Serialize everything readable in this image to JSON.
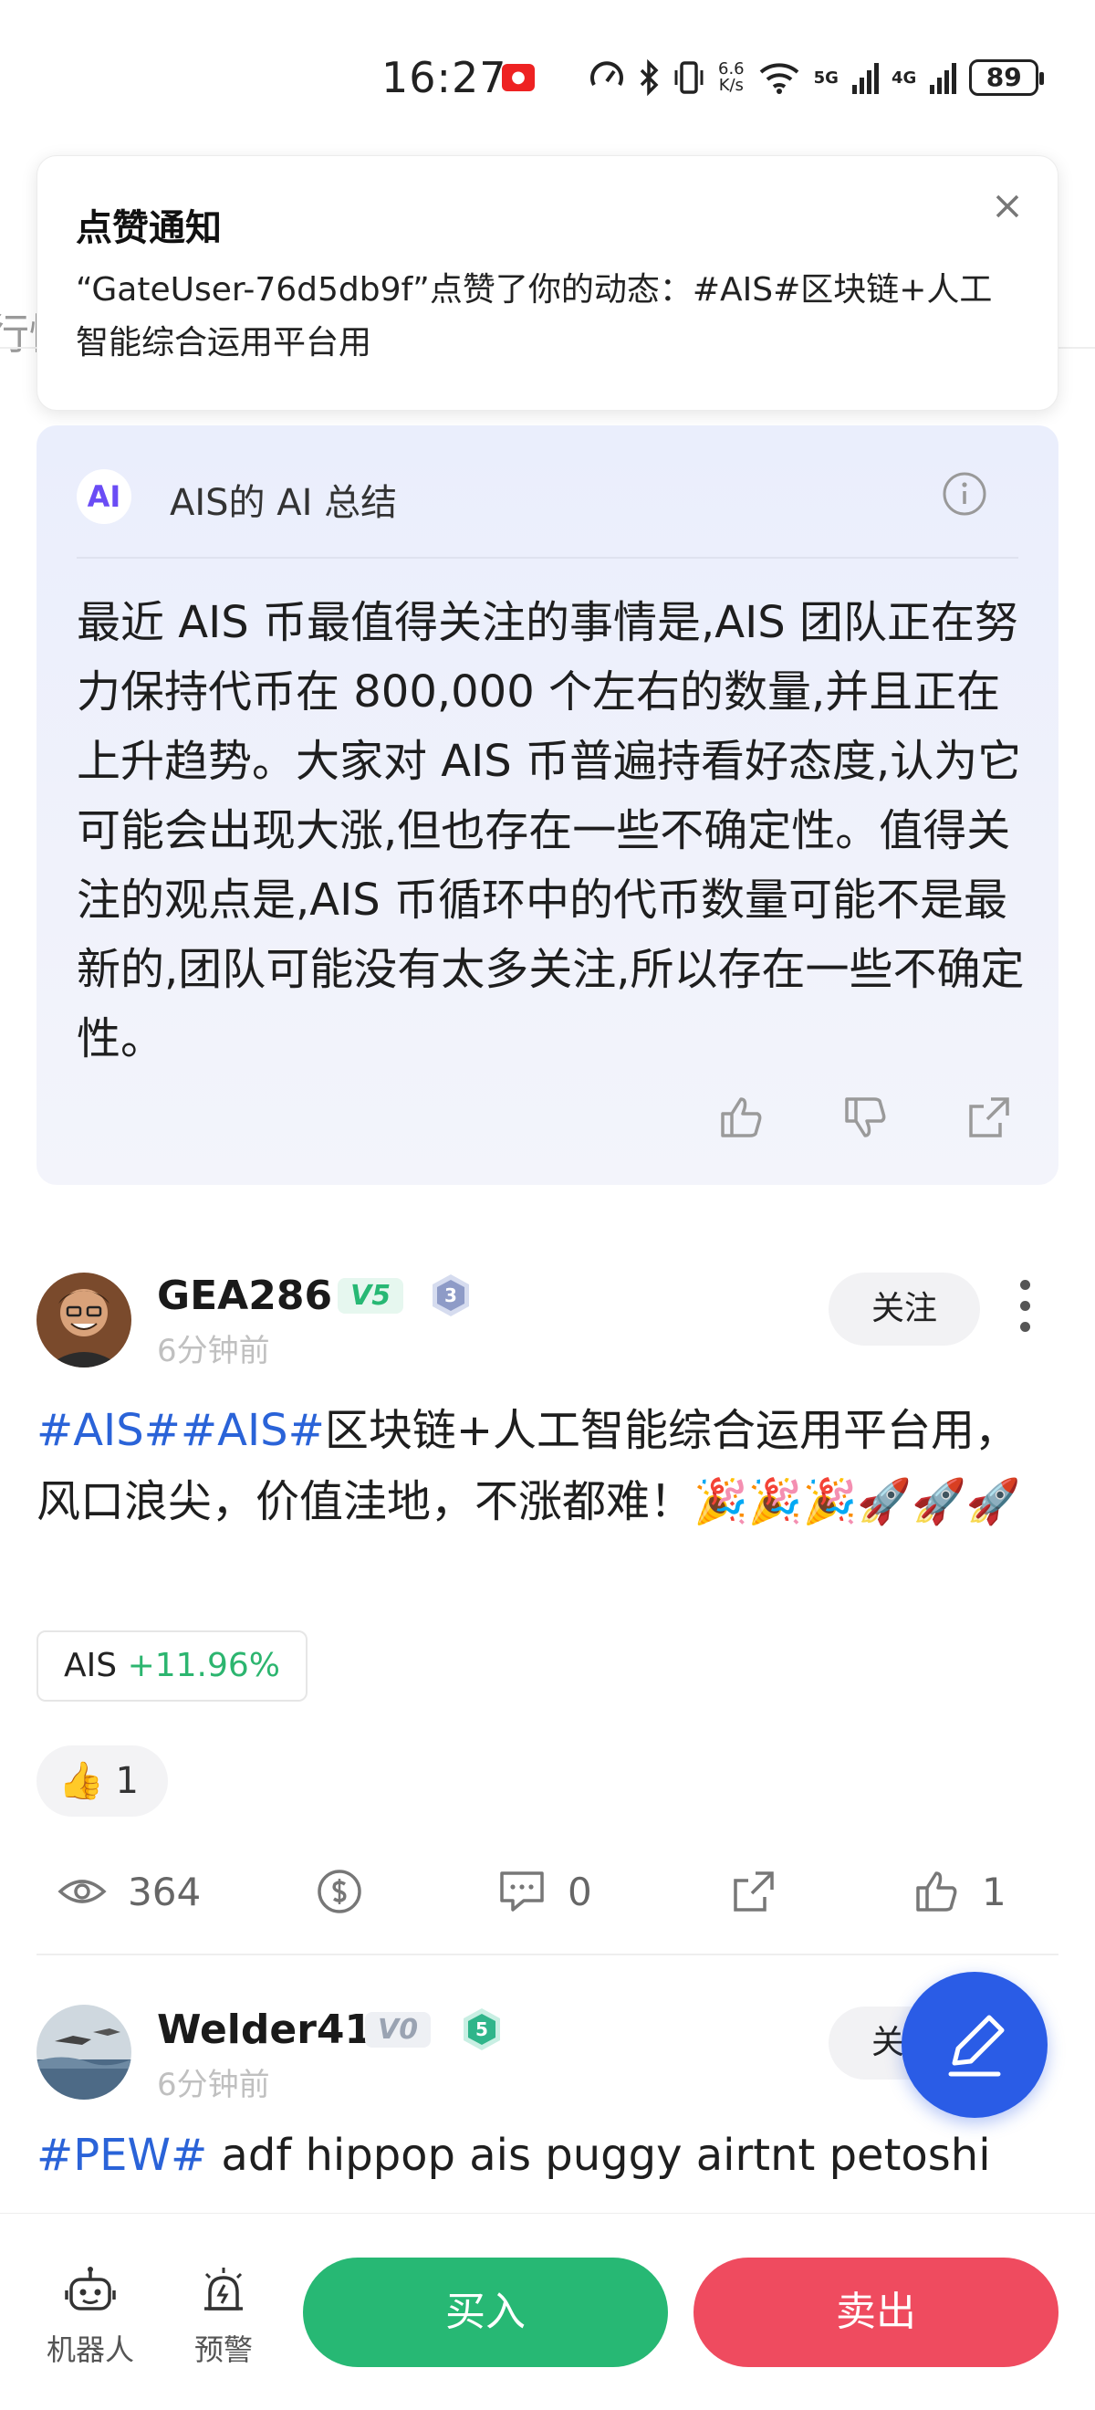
{
  "status_bar": {
    "time": "16:27",
    "net_speed_value": "6.6",
    "net_speed_unit": "K/s",
    "signal_5g": "5G",
    "signal_4g": "4G",
    "battery": "89"
  },
  "background": {
    "tab_partial": "行情"
  },
  "notification": {
    "title": "点赞通知",
    "body": "“GateUser-76d5db9f”点赞了你的动态：#AIS#区块链+人工智能综合运用平台用"
  },
  "ai_summary": {
    "badge": "AI",
    "title": "AIS的 AI 总结",
    "text": "最近 AIS 币最值得关注的事情是,AIS 团队正在努力保持代币在 800,000 个左右的数量,并且正在上升趋势。大家对 AIS 币普遍持看好态度,认为它可能会出现大涨,但也存在一些不确定性。值得关注的观点是,AIS 币循环中的代币数量可能不是最新的,团队可能没有太多关注,所以存在一些不确定性。"
  },
  "post1": {
    "username": "GEA286",
    "vip": "V5",
    "level": "3",
    "time": "6分钟前",
    "follow_label": "关注",
    "tag1": "#AIS#",
    "tag2": "#AIS#",
    "text": "区块链+人工智能综合运用平台用，风口浪尖，价值洼地，不涨都难！🎉🎉🎉🚀🚀🚀",
    "coin_symbol": "AIS",
    "coin_change": "+11.96%",
    "reaction_emoji": "👍",
    "reaction_count": "1",
    "views": "364",
    "comments": "0",
    "likes": "1"
  },
  "post2": {
    "username": "Welder41",
    "vip": "V0",
    "level": "5",
    "time": "6分钟前",
    "follow_label": "关注",
    "tag": "#PEW#",
    "text": " adf hippop ais puggy airtnt petoshi"
  },
  "bottom_bar": {
    "robot_label": "机器人",
    "alert_label": "预警",
    "buy_label": "买入",
    "sell_label": "卖出"
  },
  "colors": {
    "buy": "#27b874",
    "sell": "#ef4b5f",
    "accent": "#2a5ce6",
    "tag": "#2a63d8",
    "positive": "#2cb56f"
  }
}
